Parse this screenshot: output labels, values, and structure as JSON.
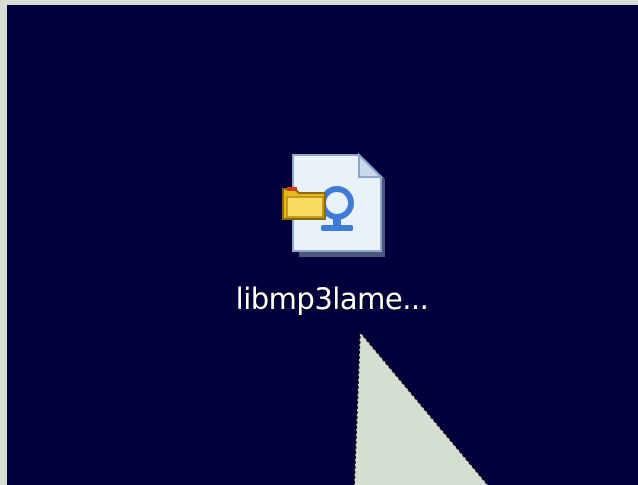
{
  "desktop": {
    "background_color": "#02003c",
    "frame_color": "#d7ddd5"
  },
  "file": {
    "icon": "dll-settings-file-icon",
    "label": "libmp3lame..."
  },
  "cursor": {
    "icon": "arrow-pointer-icon",
    "fill_color": "#d5ded2"
  }
}
